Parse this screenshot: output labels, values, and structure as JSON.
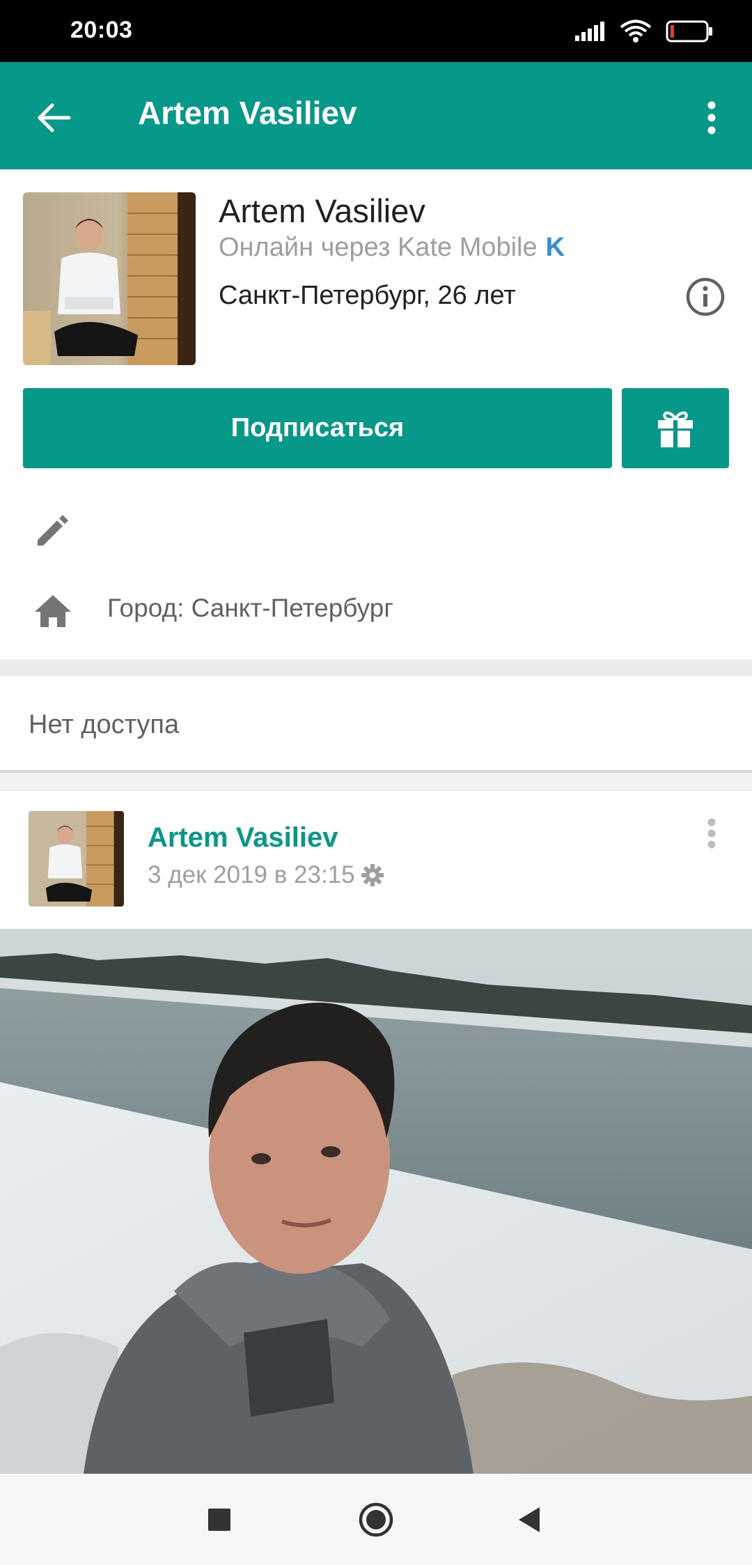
{
  "status_bar": {
    "time": "20:03",
    "icons": [
      "signal-icon",
      "wifi-icon",
      "battery-icon"
    ]
  },
  "app_bar": {
    "title": "Artem Vasiliev",
    "back_icon": "arrow-back-icon",
    "menu_icon": "more-vert-icon"
  },
  "profile": {
    "name": "Artem Vasiliev",
    "online_status": "Онлайн через Kate Mobile",
    "client_badge": "K",
    "meta": "Санкт-Петербург, 26 лет",
    "info_icon": "info-icon"
  },
  "actions": {
    "subscribe_label": "Подписаться",
    "gift_icon": "gift-icon"
  },
  "details": {
    "edit_icon": "pencil-icon",
    "city": "Город: Санкт-Петербург",
    "city_icon": "home-icon"
  },
  "wall": {
    "no_access": "Нет доступа"
  },
  "post": {
    "author": "Artem Vasiliev",
    "date": "3 дек 2019 в 23:15",
    "settings_icon": "gear-icon",
    "menu_icon": "more-vert-icon"
  },
  "nav_bar": {
    "icons": [
      "recents-square-icon",
      "home-circle-icon",
      "back-triangle-icon"
    ]
  },
  "colors": {
    "accent": "#06998a",
    "status_bar": "#000000",
    "link_blue": "#2e8ed6"
  }
}
